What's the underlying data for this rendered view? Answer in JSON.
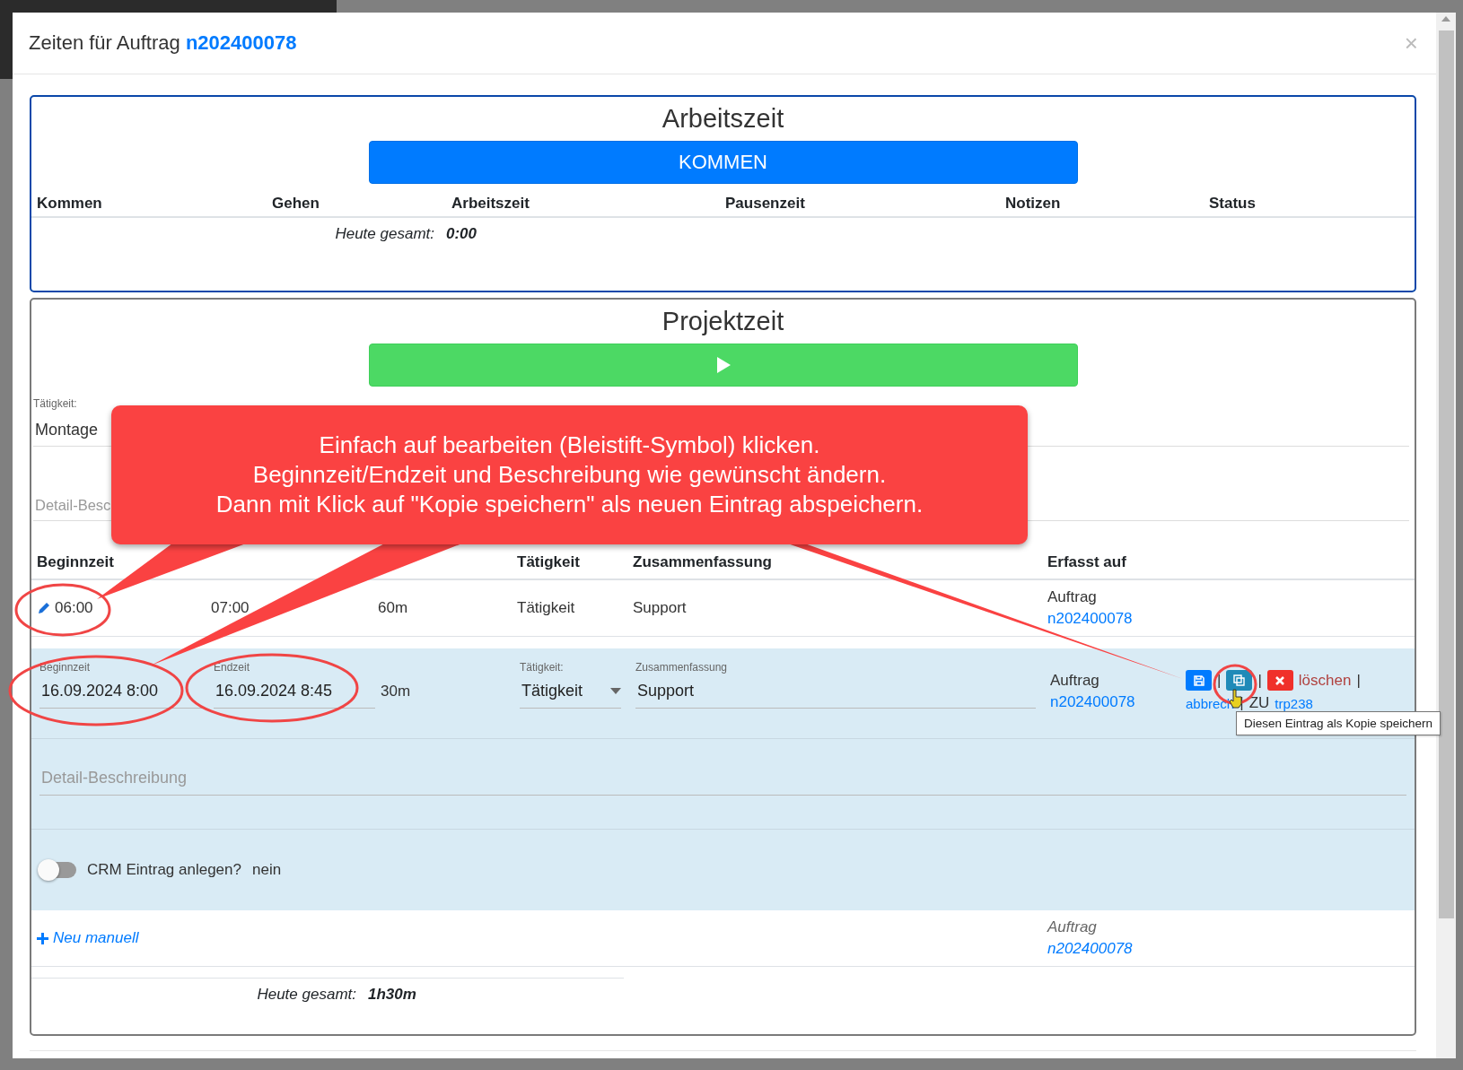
{
  "dialog": {
    "title": "Zeiten für Auftrag",
    "order_link": "n202400078",
    "close": "×"
  },
  "work_time": {
    "heading": "Arbeitszeit",
    "button": "KOMMEN",
    "columns": [
      "Kommen",
      "Gehen",
      "Arbeitszeit",
      "Pausenzeit",
      "Notizen",
      "Status"
    ],
    "total_label": "Heute gesamt:",
    "total_value": "0:00"
  },
  "project_time": {
    "heading": "Projektzeit",
    "activity_field": {
      "label": "Tätigkeit:",
      "value": "Montage"
    },
    "detail_field": {
      "placeholder": "Detail-Besc"
    },
    "table": {
      "columns": {
        "column_1": "Beginnzeit",
        "column_4": "Tätigkeit",
        "column_5": "Zusammenfassung",
        "column_6": "Erfasst auf"
      },
      "rows": [
        {
          "kind": "view",
          "cells": [
            "06:00",
            "07:00",
            "60m",
            "Tätigkeit",
            "Support"
          ],
          "source_label": "Auftrag",
          "source_link": "n202400078"
        },
        {
          "kind": "edit",
          "begin": {
            "label": "Beginnzeit",
            "value": "16.09.2024 8:00"
          },
          "end": {
            "label": "Endzeit",
            "value": "16.09.2024 8:45"
          },
          "duration": "30m",
          "activity": {
            "label": "Tätigkeit:",
            "value": "Tätigkeit"
          },
          "summary": {
            "label": "Zusammenfassung",
            "value": "Support"
          },
          "source_label": "Auftrag",
          "source_link": "n202400078",
          "actions": {
            "separator_1": "|",
            "separator_2": "|",
            "delete": "löschen",
            "separator_3": "|",
            "cancel": "abbrech",
            "separator_4": "|",
            "zu": "ZU",
            "ref": "trp238"
          },
          "tooltip": "Diesen Eintrag als Kopie speichern",
          "detail_placeholder": "Detail-Beschreibung",
          "crm": {
            "label": "CRM Eintrag anlegen?",
            "on": false,
            "value": "nein"
          }
        }
      ]
    },
    "new_entry": {
      "link": "Neu manuell",
      "source_label": "Auftrag",
      "source_link": "n202400078"
    },
    "total": {
      "label": "Heute gesamt:",
      "value": "1h30m"
    }
  },
  "callout": {
    "lines": [
      "Einfach auf bearbeiten (Bleistift-Symbol) klicken.",
      "Beginnzeit/Endzeit und Beschreibung wie gewünscht ändern.",
      "Dann mit Klick auf \"Kopie speichern\" als neuen Eintrag abspeichern."
    ]
  }
}
